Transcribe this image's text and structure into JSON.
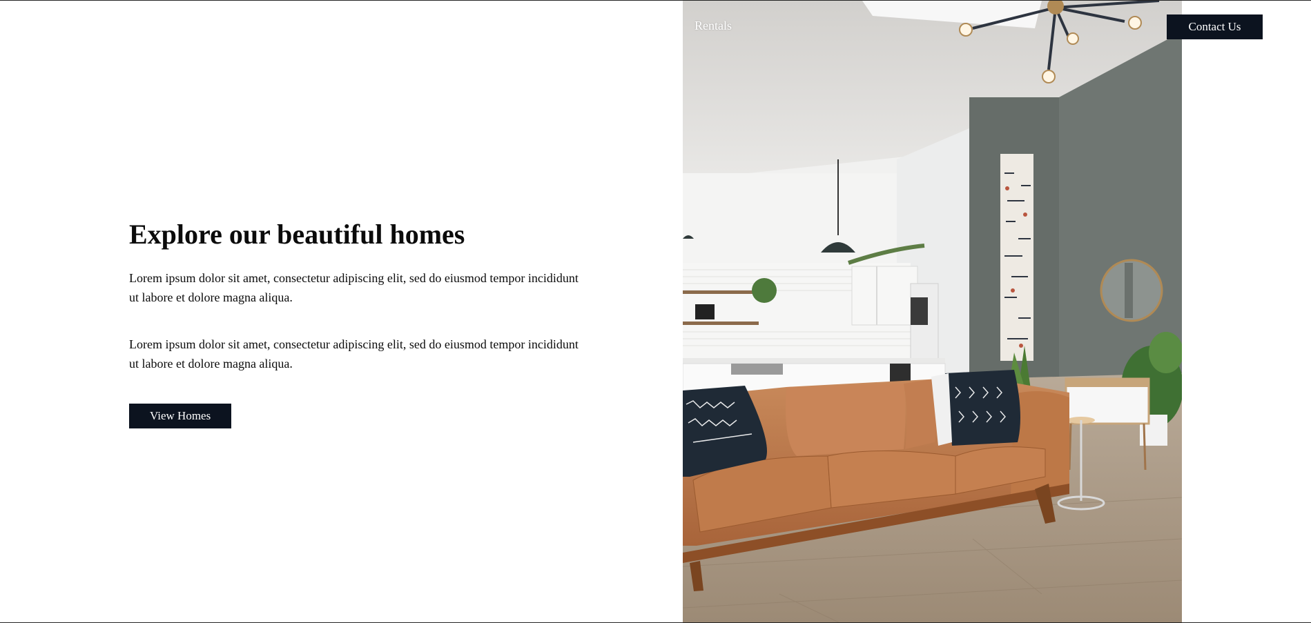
{
  "nav": {
    "rentals_label": "Rentals",
    "contact_label": "Contact Us"
  },
  "hero": {
    "title": "Explore our beautiful homes",
    "paragraphs": [
      "Lorem ipsum dolor sit amet, consectetur adipiscing elit, sed do eiusmod tempor incididunt ut labore et dolore magna aliqua.",
      "Lorem ipsum dolor sit amet, consectetur adipiscing elit, sed do eiusmod tempor incididunt ut labore et dolore magna aliqua."
    ],
    "button_label": "View Homes"
  },
  "colors": {
    "button_bg": "#0c131f",
    "button_text": "#ffffff",
    "text": "#0b0b0b",
    "page_bg": "#ffffff"
  },
  "photo": {
    "subject": "living-room-photo"
  }
}
